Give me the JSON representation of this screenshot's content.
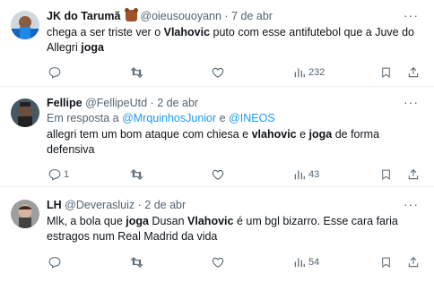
{
  "tweets": [
    {
      "author_name": "JK do Tarumã",
      "handle": "@oieusouoyann",
      "separator": "·",
      "date": "7 de abr",
      "has_bear_emoji": true,
      "text_parts": [
        "chega a ser triste ver o ",
        "Vlahovic",
        " puto com esse antifutebol que a Juve do Allegri ",
        "joga"
      ],
      "replies": "",
      "retweets": "",
      "likes": "",
      "views": "232"
    },
    {
      "author_name": "Fellipe",
      "handle": "@FellipeUtd",
      "separator": "·",
      "date": "2 de abr",
      "reply_prefix": "Em resposta a ",
      "reply_user1": "@MrquinhosJunior",
      "reply_and": " e ",
      "reply_user2": "@INEOS",
      "text_parts": [
        "allegri tem um bom ataque com chiesa e ",
        "vlahovic",
        " e ",
        "joga",
        " de forma defensiva"
      ],
      "replies": "1",
      "retweets": "",
      "likes": "",
      "views": "43"
    },
    {
      "author_name": "LH",
      "handle": "@Deverasluiz",
      "separator": "·",
      "date": "2 de abr",
      "text_parts": [
        "Mlk, a bola que ",
        "joga",
        " Dusan ",
        "Vlahovic",
        " é um bgl bizarro. Esse cara faria estragos num Real Madrid da vida"
      ],
      "replies": "",
      "retweets": "",
      "likes": "",
      "views": "54"
    }
  ],
  "more_label": "···",
  "colors": {
    "text": "#0f1419",
    "muted": "#536471",
    "link": "#1d9bf0",
    "divider": "#eff3f4"
  },
  "icons": [
    "reply-icon",
    "retweet-icon",
    "like-icon",
    "views-icon",
    "bookmark-icon",
    "share-icon",
    "more-icon"
  ]
}
